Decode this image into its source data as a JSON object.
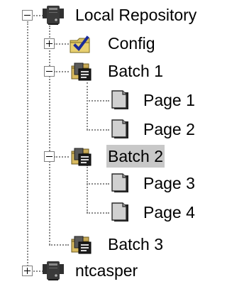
{
  "tree": {
    "root": {
      "label": "Local Repository",
      "icon": "server-icon",
      "expanded": true
    },
    "config": {
      "label": "Config",
      "icon": "config-folder-icon",
      "expanded": false
    },
    "batch1": {
      "label": "Batch 1",
      "icon": "batch-folder-icon",
      "expanded": true,
      "pages": [
        {
          "label": "Page 1",
          "icon": "page-icon"
        },
        {
          "label": "Page 2",
          "icon": "page-icon"
        }
      ]
    },
    "batch2": {
      "label": "Batch 2",
      "icon": "batch-folder-icon",
      "expanded": true,
      "selected": true,
      "pages": [
        {
          "label": "Page 3",
          "icon": "page-icon"
        },
        {
          "label": "Page 4",
          "icon": "page-icon"
        }
      ]
    },
    "batch3": {
      "label": "Batch 3",
      "icon": "batch-folder-icon"
    },
    "ntcasper": {
      "label": "ntcasper",
      "icon": "server-icon",
      "expanded": false
    }
  },
  "colors": {
    "selection": "#c8c8c8",
    "folder": "#d8c060",
    "check": "#1a2a9a",
    "page": "#d0d0d0",
    "server": "#2a2a2a"
  }
}
